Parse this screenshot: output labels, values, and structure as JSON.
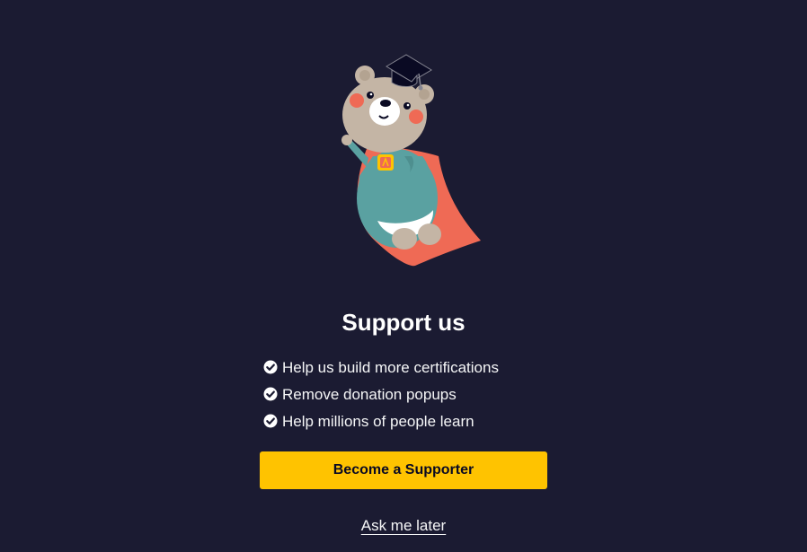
{
  "modal": {
    "illustration_icon": "flying-graduate-bear-icon",
    "title": "Support us",
    "benefits": [
      {
        "icon": "check-circle-icon",
        "label": "Help us build more certifications"
      },
      {
        "icon": "check-circle-icon",
        "label": "Remove donation popups"
      },
      {
        "icon": "check-circle-icon",
        "label": "Help millions of people learn"
      }
    ],
    "primary_button": "Become a Supporter",
    "secondary_link": "Ask me later"
  },
  "colors": {
    "background": "#1b1b32",
    "button": "#ffc300",
    "text": "#ffffff"
  }
}
